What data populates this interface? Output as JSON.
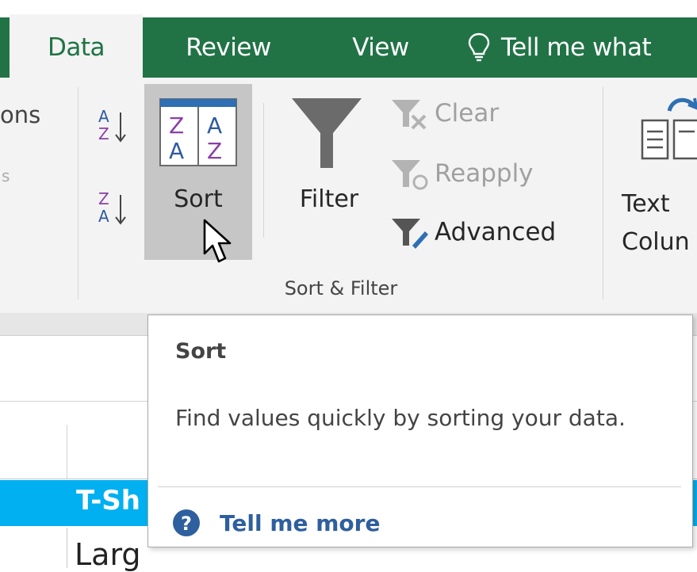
{
  "tabs": {
    "data": "Data",
    "review": "Review",
    "view": "View",
    "tell_me": "Tell me what"
  },
  "ribbon": {
    "left_fragment": "ons",
    "left_fragment_small": "s",
    "sort_label": "Sort",
    "filter_label": "Filter",
    "clear_label": "Clear",
    "reapply_label": "Reapply",
    "advanced_label": "Advanced",
    "group_label": "Sort & Filter",
    "text_to_columns_line1": "Text",
    "text_to_columns_line2": "Colun"
  },
  "tooltip": {
    "title": "Sort",
    "description": "Find values quickly by sorting your data.",
    "link": "Tell me more"
  },
  "sheet": {
    "header_cell": "T-Sh",
    "cell_value": "Larg"
  },
  "colors": {
    "excel_green": "#217346",
    "ribbon_bg": "#f3f3f3",
    "selected_button": "#c6c6c6",
    "header_cyan": "#00b0f0",
    "link_blue": "#2e5f9e",
    "az_blue": "#2f5a9e",
    "az_purple": "#8a3fa8"
  }
}
